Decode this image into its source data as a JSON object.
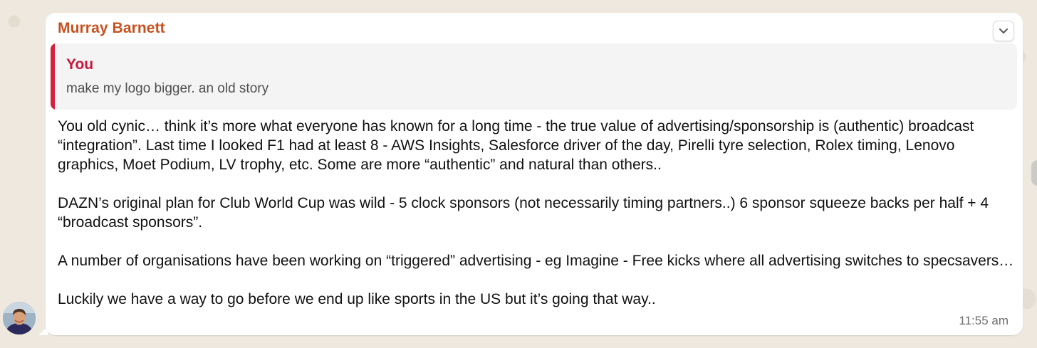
{
  "message": {
    "sender_name": "Murray Barnett",
    "timestamp": "11:55 am",
    "quoted": {
      "author": "You",
      "text": "make my logo bigger. an old story"
    },
    "paragraphs": [
      "You old cynic… think it’s more what everyone has known for a long time - the true value of advertising/sponsorship is (authentic) broadcast “integration”. Last time I looked F1 had at least 8 - AWS Insights, Salesforce driver of the day, Pirelli tyre selection, Rolex timing, Lenovo graphics, Moet Podium, LV trophy, etc. Some are more “authentic” and natural than others..",
      "DAZN’s original plan for Club World Cup was wild - 5 clock sponsors (not necessarily timing partners..) 6 sponsor squeeze backs per half + 4 “broadcast sponsors”.",
      "A number of organisations have been working on “triggered” advertising - eg Imagine - Free kicks where all advertising switches to specsavers…",
      "Luckily we have a way to go before we end up like sports in the US but it’s going that way.."
    ]
  },
  "icons": {
    "menu": "chevron-down-icon",
    "avatar": "user-avatar"
  },
  "colors": {
    "sender": "#c8501e",
    "quote_author": "#c8173b",
    "quote_bar": "#d6203f",
    "bubble": "#ffffff",
    "background": "#efe8de"
  }
}
